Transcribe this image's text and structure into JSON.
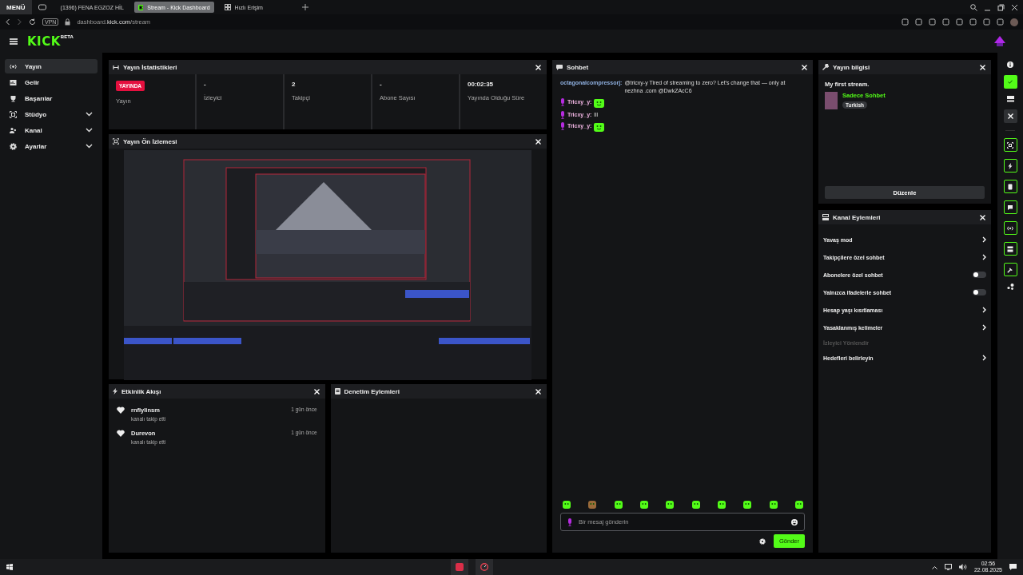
{
  "browser": {
    "menu": "MENÜ",
    "tabs": [
      {
        "label": "(1396) FENA EGZOZ HİL",
        "kind": "video",
        "selected": false
      },
      {
        "label": "Stream - Kick Dashboard",
        "kind": "kick",
        "selected": true
      },
      {
        "label": "Hızlı Erişim",
        "kind": "grid",
        "selected": false
      }
    ],
    "vpn": "VPN",
    "url": "dashboard.**kick.com**/stream"
  },
  "header": {
    "logo": "KICK",
    "logo_badge": "BETA"
  },
  "sidebar": {
    "items": [
      {
        "label": "Yayın",
        "kind": "link",
        "selected": true
      },
      {
        "label": "Gelir",
        "kind": "link",
        "selected": false
      },
      {
        "label": "Başarılar",
        "kind": "link",
        "selected": false
      },
      {
        "label": "Stüdyo",
        "kind": "group",
        "selected": false
      },
      {
        "label": "Kanal",
        "kind": "group",
        "selected": false
      },
      {
        "label": "Ayarlar",
        "kind": "group",
        "selected": false
      }
    ]
  },
  "stats": {
    "title": "Yayın İstatistikleri",
    "cells": [
      {
        "kind": "badge",
        "value": "YAYINDA",
        "label": "Yayın"
      },
      {
        "kind": "value",
        "value": "-",
        "label": "İzleyici"
      },
      {
        "kind": "value",
        "value": "2",
        "label": "Takipçi"
      },
      {
        "kind": "value",
        "value": "-",
        "label": "Abone Sayısı"
      },
      {
        "kind": "value",
        "value": "00:02:35",
        "label": "Yayında Olduğu Süre"
      }
    ]
  },
  "preview": {
    "title": "Yayın Ön İzlemesi"
  },
  "events": {
    "title": "Etkinlik Akışı",
    "items": [
      {
        "name": "rnflylinsm",
        "action": "kanalı takip etti",
        "time": "1 gün önce"
      },
      {
        "name": "Durevon",
        "action": "kanalı takip etti",
        "time": "1 gün önce"
      }
    ]
  },
  "moderation": {
    "title": "Denetim Eylemleri"
  },
  "chat": {
    "title": "Sohbet",
    "messages": [
      {
        "user": "octagonalcompressorj:",
        "color": "#8fb0e0",
        "badge": false,
        "kind": "text",
        "text": "@tricxy-y Tired of streaming to zero? Let's change that — only at nezhna .com @DwkZAcC6"
      },
      {
        "user": "Tricxy_y:",
        "color": "#f2b6e4",
        "badge": true,
        "kind": "emote"
      },
      {
        "user": "Tricxy_y:",
        "color": "#f2b6e4",
        "badge": true,
        "kind": "text",
        "text": "lll"
      },
      {
        "user": "Tricxy_y:",
        "color": "#f2b6e4",
        "badge": true,
        "kind": "emote"
      }
    ],
    "placeholder": "Bir mesaj gönderin",
    "send": "Gönder"
  },
  "stream_info": {
    "title": "Yayın bilgisi",
    "stream_title": "My first stream.",
    "category": "Sadece Sohbet",
    "tag": "Turkish",
    "edit": "Düzenle"
  },
  "channel_actions": {
    "title": "Kanal Eylemleri",
    "items": [
      {
        "label": "Yavaş mod",
        "kind": "link"
      },
      {
        "label": "Takipçilere özel sohbet",
        "kind": "link"
      },
      {
        "label": "Abonelere özel sohbet",
        "kind": "toggle",
        "on": false
      },
      {
        "label": "Yalnızca ifadelerle sohbet",
        "kind": "toggle",
        "on": false
      },
      {
        "label": "Hesap yaşı kısıtlaması",
        "kind": "link"
      },
      {
        "label": "Yasaklanmış kelimeler",
        "kind": "link"
      },
      {
        "label": "İzleyici Yönlendir",
        "kind": "heading"
      },
      {
        "label": "Hedefleri belirleyin",
        "kind": "link"
      }
    ]
  },
  "taskbar": {
    "time": "02:56",
    "date": "22.08.2025"
  }
}
